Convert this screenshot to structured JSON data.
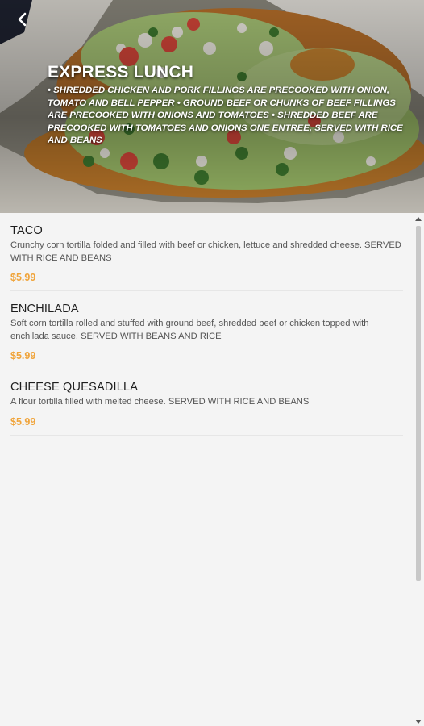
{
  "header": {
    "title": "EXPRESS LUNCH",
    "description": "• SHREDDED CHICKEN AND PORK FILLINGS ARE PRECOOKED WITH ONION, TOMATO AND BELL PEPPER • GROUND BEEF OR CHUNKS OF BEEF FILLINGS ARE PRECOOKED WITH ONIONS AND TOMATOES • SHREDDED BEEF ARE PRECOOKED WITH TOMATOES AND ONIONS ONE ENTREE, SERVED WITH RICE AND BEANS",
    "back_icon": "chevron-left-icon",
    "image": "taco-photo"
  },
  "menu": {
    "items": [
      {
        "name": "TACO",
        "description": "Crunchy corn tortilla folded and filled with beef or chicken, lettuce and shredded cheese. SERVED WITH RICE AND BEANS",
        "price": "$5.99"
      },
      {
        "name": "ENCHILADA",
        "description": "Soft corn tortilla rolled and stuffed with ground beef, shredded beef or chicken topped with enchilada sauce. SERVED WITH BEANS AND RICE",
        "price": "$5.99"
      },
      {
        "name": "CHEESE QUESADILLA",
        "description": "A flour tortilla filled with melted cheese. SERVED WITH RICE AND BEANS",
        "price": "$5.99"
      }
    ]
  },
  "colors": {
    "price": "#f0a43a",
    "background": "#f4f4f4"
  }
}
